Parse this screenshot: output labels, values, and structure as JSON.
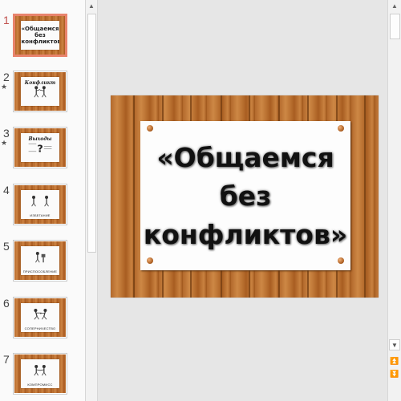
{
  "thumbnails": [
    {
      "number": "1",
      "title": "«Общаемся без конфликтов»",
      "caption": "",
      "has_animation": false,
      "selected": true
    },
    {
      "number": "2",
      "title": "Конфликт",
      "caption": "",
      "has_animation": true,
      "selected": false
    },
    {
      "number": "3",
      "title": "Выходы",
      "caption": "",
      "has_animation": true,
      "selected": false
    },
    {
      "number": "4",
      "title": "",
      "caption": "ИЗБЕГАНИЕ",
      "has_animation": false,
      "selected": false
    },
    {
      "number": "5",
      "title": "",
      "caption": "ПРИСПОСОБЛЕНИЕ",
      "has_animation": false,
      "selected": false
    },
    {
      "number": "6",
      "title": "",
      "caption": "СОПЕРНИЧЕСТВО",
      "has_animation": false,
      "selected": false
    },
    {
      "number": "7",
      "title": "",
      "caption": "КОМПРОМИСС",
      "has_animation": false,
      "selected": false
    }
  ],
  "animation_marker": "★",
  "main_slide": {
    "title_lines": [
      "«Общаемся",
      "без",
      "конфликтов»"
    ]
  },
  "icons": {
    "scroll_up": "▲",
    "scroll_down": "▼",
    "previous_slide": "⏫",
    "next_slide": "⏬"
  }
}
